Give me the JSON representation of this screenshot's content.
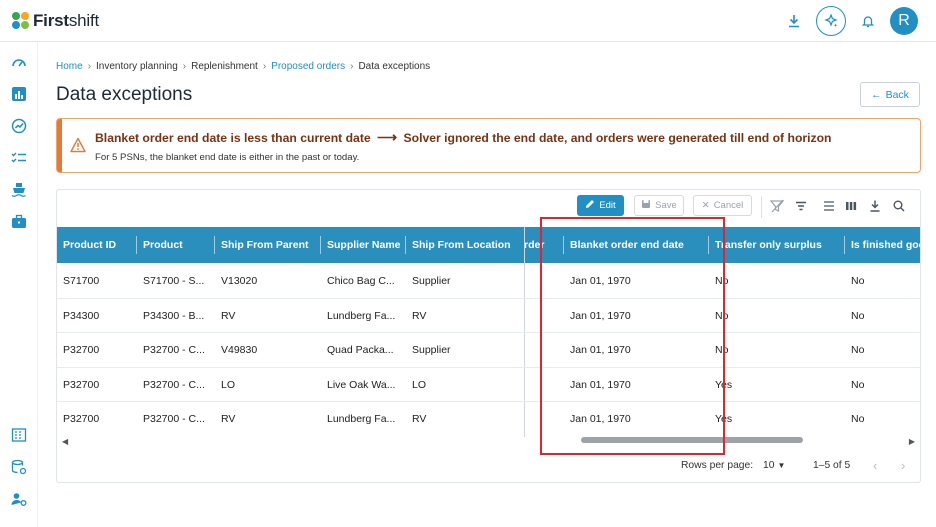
{
  "app": {
    "brand_bold": "First",
    "brand_light": "shift",
    "avatar_initial": "R"
  },
  "breadcrumb": [
    {
      "label": "Home",
      "link": true
    },
    {
      "label": "Inventory planning",
      "link": false
    },
    {
      "label": "Replenishment",
      "link": false
    },
    {
      "label": "Proposed orders",
      "link": true
    },
    {
      "label": "Data exceptions",
      "link": false
    }
  ],
  "page": {
    "title": "Data exceptions",
    "back_label": "Back"
  },
  "alert": {
    "title_left": "Blanket order end date is less than current date",
    "title_right": "Solver ignored the end date, and orders were generated till end of horizon",
    "description": "For 5 PSNs, the blanket end date is either in the past or today."
  },
  "toolbar": {
    "edit_label": "Edit",
    "save_label": "Save",
    "cancel_label": "Cancel"
  },
  "table": {
    "columns": [
      "Product ID",
      "Product",
      "Ship From Parent",
      "Supplier Name",
      "Ship From Location",
      "rder",
      "Blanket order end date",
      "Transfer only surplus",
      "Is finished goo"
    ],
    "rows": [
      [
        "S71700",
        "S71700 - S...",
        "V13020",
        "Chico Bag C...",
        "Supplier",
        "",
        "Jan 01, 1970",
        "No",
        "No"
      ],
      [
        "P34300",
        "P34300 - B...",
        "RV",
        "Lundberg Fa...",
        "RV",
        "",
        "Jan 01, 1970",
        "No",
        "No"
      ],
      [
        "P32700",
        "P32700 - C...",
        "V49830",
        "Quad Packa...",
        "Supplier",
        "",
        "Jan 01, 1970",
        "No",
        "No"
      ],
      [
        "P32700",
        "P32700 - C...",
        "LO",
        "Live Oak Wa...",
        "LO",
        "",
        "Jan 01, 1970",
        "Yes",
        "No"
      ],
      [
        "P32700",
        "P32700 - C...",
        "RV",
        "Lundberg Fa...",
        "RV",
        "",
        "Jan 01, 1970",
        "Yes",
        "No"
      ]
    ]
  },
  "pagination": {
    "rows_per_page_label": "Rows per page:",
    "rows_per_page": "10",
    "range": "1–5 of 5"
  },
  "colors": {
    "accent": "#1f8fc4",
    "header_bg": "#2a8fbd",
    "alert_border": "#e07b39",
    "alert_title": "#7a3212",
    "highlight": "#e0262d"
  },
  "icons": {
    "topbar": [
      "download-icon",
      "ai-sparkle-icon",
      "bell-icon"
    ],
    "sidebar": [
      "dashboard-icon",
      "bar-chart-icon",
      "trend-icon",
      "checklist-icon",
      "ship-icon",
      "briefcase-icon",
      "building-icon",
      "database-settings-icon",
      "users-settings-icon"
    ],
    "toolbar": [
      "clear-filter-icon",
      "filter-icon",
      "density-icon",
      "columns-icon",
      "export-icon",
      "search-icon"
    ]
  }
}
